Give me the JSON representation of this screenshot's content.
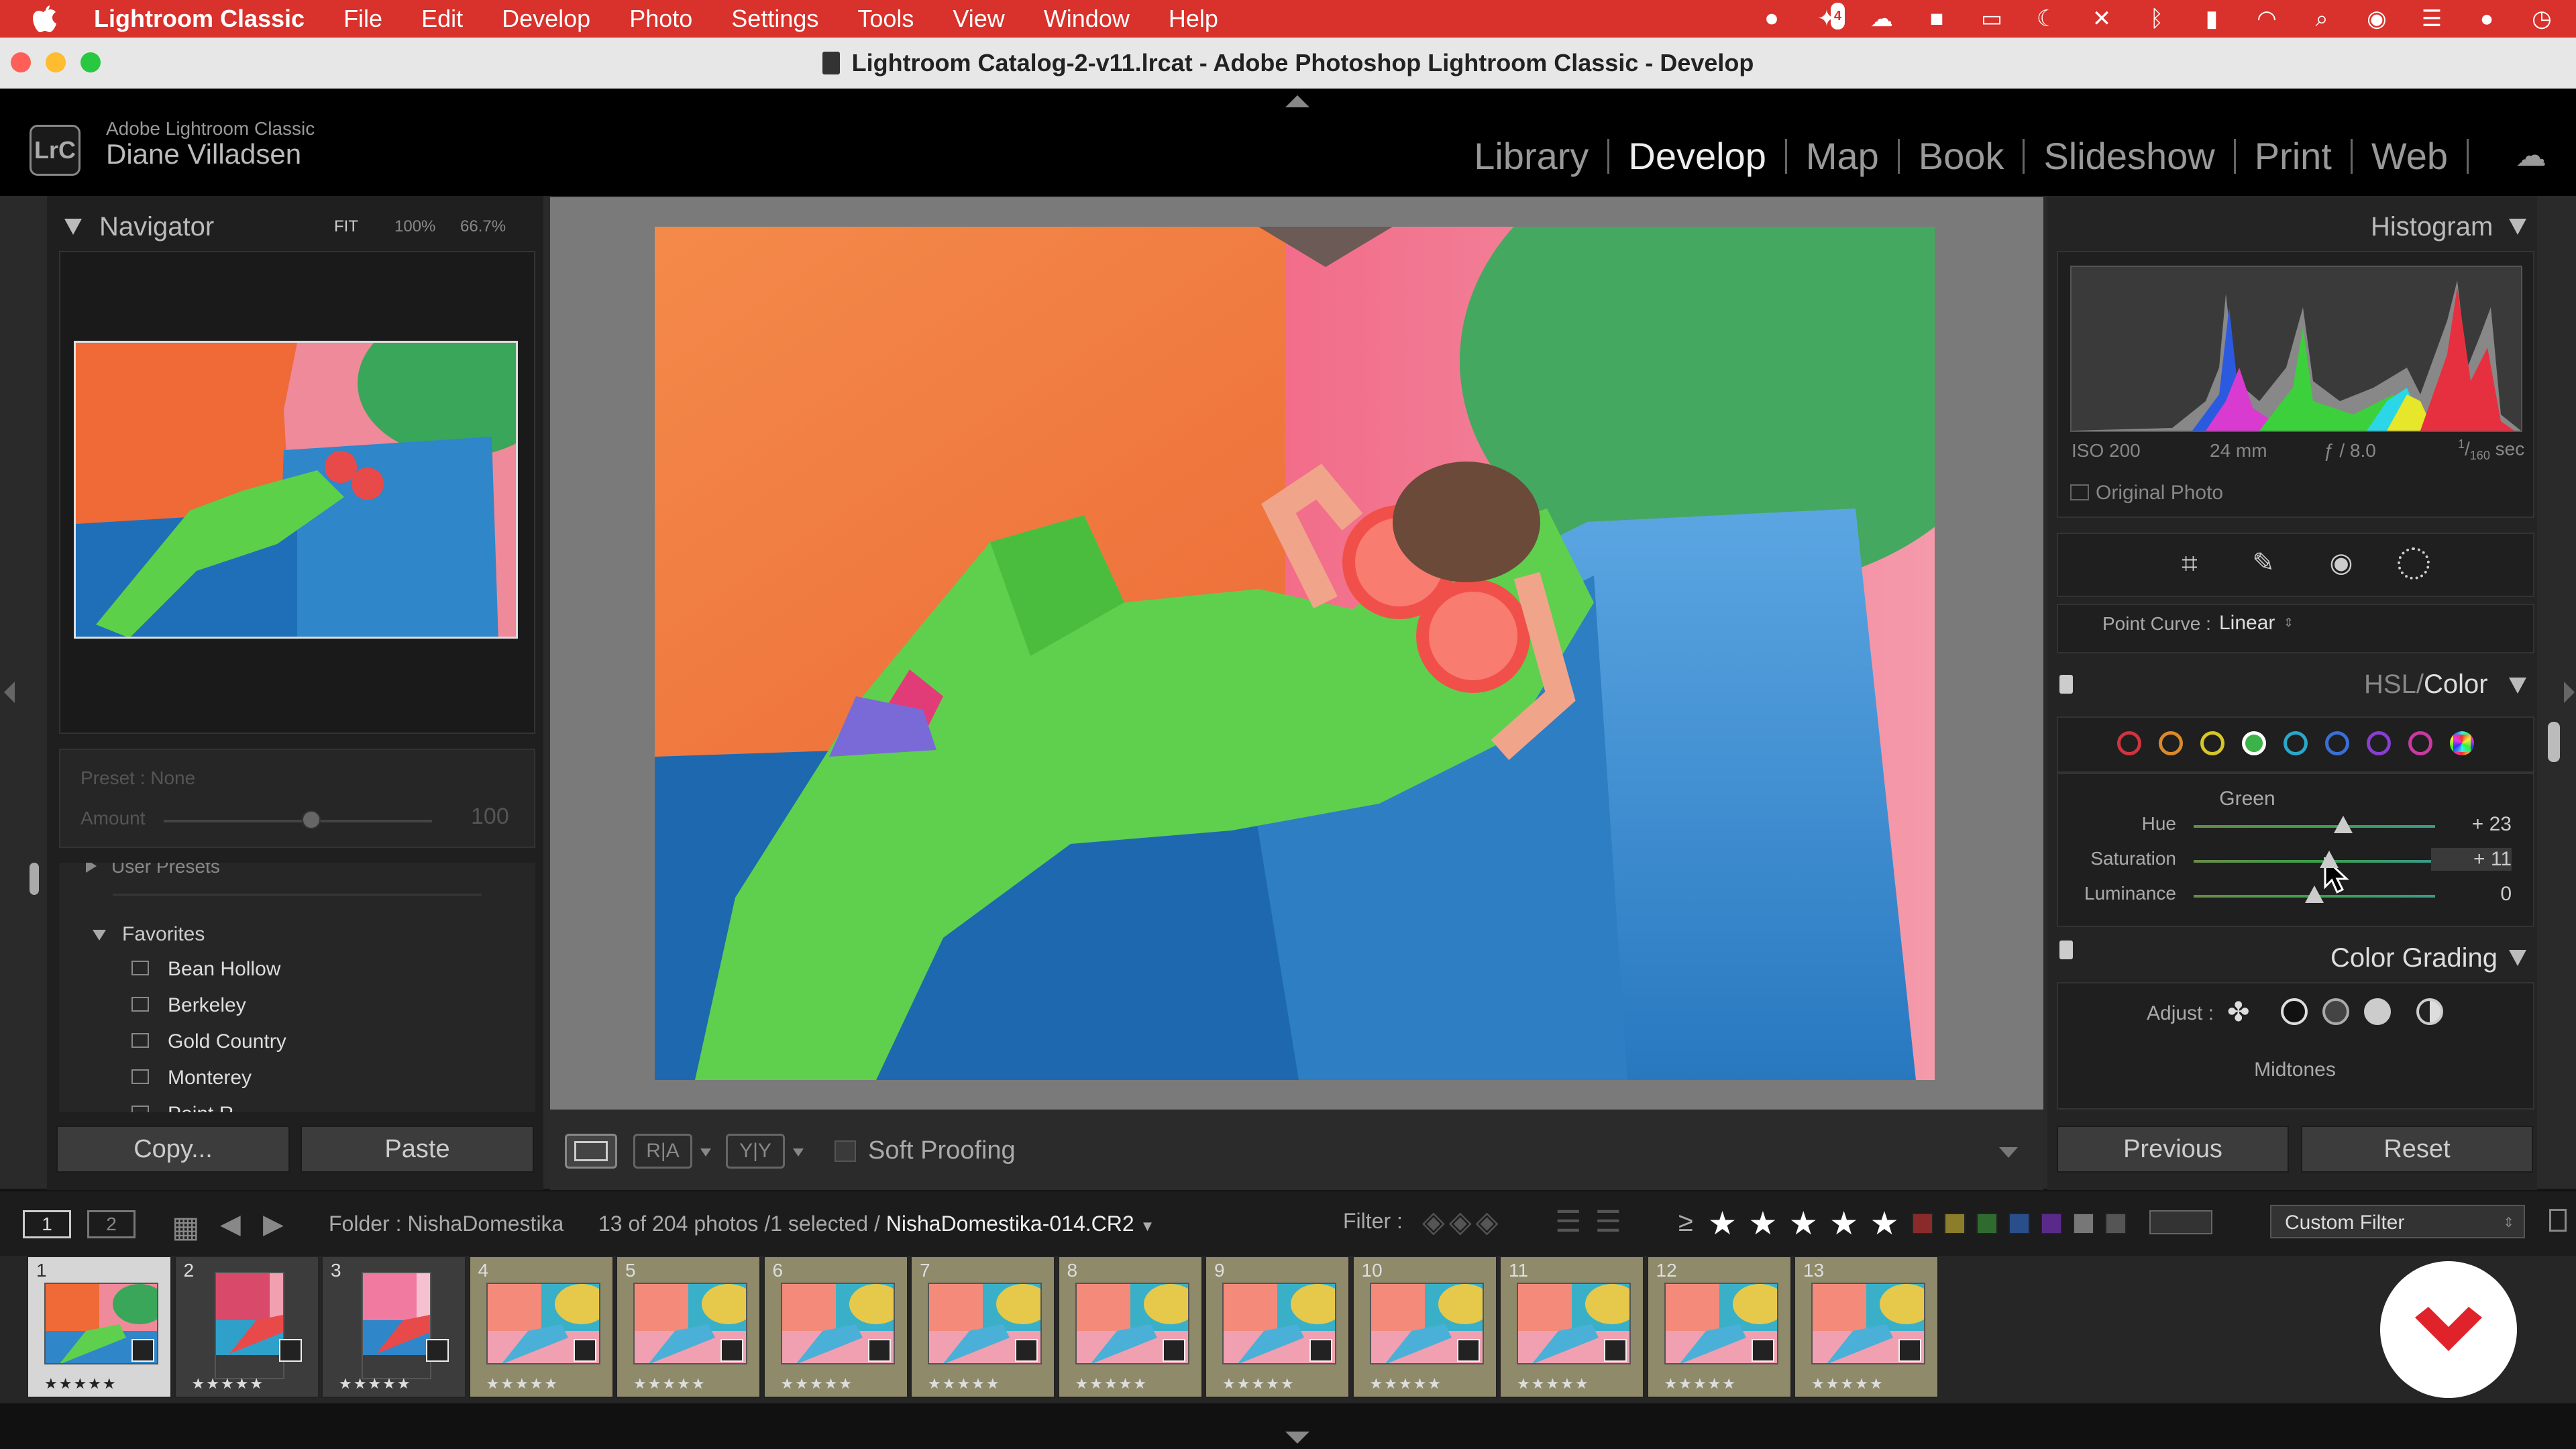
{
  "menubar": {
    "app": "Lightroom Classic",
    "items": [
      "File",
      "Edit",
      "Develop",
      "Photo",
      "Settings",
      "Tools",
      "View",
      "Window",
      "Help"
    ],
    "tray_badge": "4"
  },
  "titlebar": {
    "title": "Lightroom Catalog-2-v11.lrcat - Adobe Photoshop Lightroom Classic - Develop"
  },
  "header": {
    "logo": "LrC",
    "product": "Adobe Lightroom Classic",
    "user": "Diane Villadsen",
    "modules": [
      "Library",
      "Develop",
      "Map",
      "Book",
      "Slideshow",
      "Print",
      "Web"
    ],
    "active_module": "Develop"
  },
  "navigator": {
    "title": "Navigator",
    "zoom_fit": "FIT",
    "zoom_100": "100%",
    "zoom_custom": "66.7%"
  },
  "preset": {
    "preset_label": "Preset : None",
    "amount_label": "Amount",
    "amount_value": "100",
    "amount": 0.55
  },
  "presets": {
    "user_presets": "User Presets",
    "favorites": "Favorites",
    "items": [
      "Bean Hollow",
      "Berkeley",
      "Gold Country",
      "Monterey",
      "Point R..."
    ]
  },
  "left_buttons": {
    "copy": "Copy...",
    "paste": "Paste"
  },
  "toolbar": {
    "soft_proofing": "Soft Proofing",
    "ra": "R|A",
    "yy": "Y|Y"
  },
  "histogram": {
    "title": "Histogram",
    "iso": "ISO 200",
    "focal": "24 mm",
    "aperture": "ƒ / 8.0",
    "shutter_num": "1",
    "shutter_den": "160",
    "shutter_unit": "sec",
    "original_photo": "Original Photo"
  },
  "point_curve": {
    "label": "Point Curve :",
    "value": "Linear"
  },
  "hsl": {
    "title_hsl": "HSL",
    "title_sep": "/",
    "title_color": "Color",
    "selected": "Green",
    "swatches": [
      "#d0343f",
      "#d98a2a",
      "#d6c62a",
      "#3cb34a",
      "#2aa7c9",
      "#3a6fd6",
      "#8a3ed0",
      "#c93aa0",
      "rainbow"
    ],
    "sliders": [
      {
        "label": "Hue",
        "value": "+ 23",
        "pos": 0.62
      },
      {
        "label": "Saturation",
        "value": "+ 11",
        "pos": 0.56
      },
      {
        "label": "Luminance",
        "value": "0",
        "pos": 0.5
      }
    ]
  },
  "color_grading": {
    "title": "Color Grading",
    "adjust": "Adjust :",
    "section": "Midtones"
  },
  "right_buttons": {
    "previous": "Previous",
    "reset": "Reset"
  },
  "filmbar": {
    "view1": "1",
    "view2": "2",
    "folder": "Folder : NishaDomestika",
    "count": "13 of 204 photos /1 selected /",
    "filename": "NishaDomestika-014.CR2",
    "filter_label": "Filter :",
    "rating_op": "≥",
    "stars": "★ ★ ★ ★ ★",
    "custom_filter": "Custom Filter",
    "color_labels": [
      "#8b2a2a",
      "#8b7d2a",
      "#2f6b2f",
      "#2a4d8b",
      "#5a2a8b",
      "#777777",
      "#555555"
    ]
  },
  "filmstrip": {
    "cells": [
      {
        "num": "1",
        "stars": "★★★★★"
      },
      {
        "num": "2",
        "stars": "★★★★★"
      },
      {
        "num": "3",
        "stars": "★★★★★"
      },
      {
        "num": "4",
        "stars": "★★★★★"
      },
      {
        "num": "5",
        "stars": "★★★★★"
      },
      {
        "num": "6",
        "stars": "★★★★★"
      },
      {
        "num": "7",
        "stars": "★★★★★"
      },
      {
        "num": "8",
        "stars": "★★★★★"
      },
      {
        "num": "9",
        "stars": "★★★★★"
      },
      {
        "num": "10",
        "stars": "★★★★★"
      },
      {
        "num": "11",
        "stars": "★★★★★"
      },
      {
        "num": "12",
        "stars": "★★★★★"
      },
      {
        "num": "13",
        "stars": "★★★★★"
      }
    ]
  }
}
